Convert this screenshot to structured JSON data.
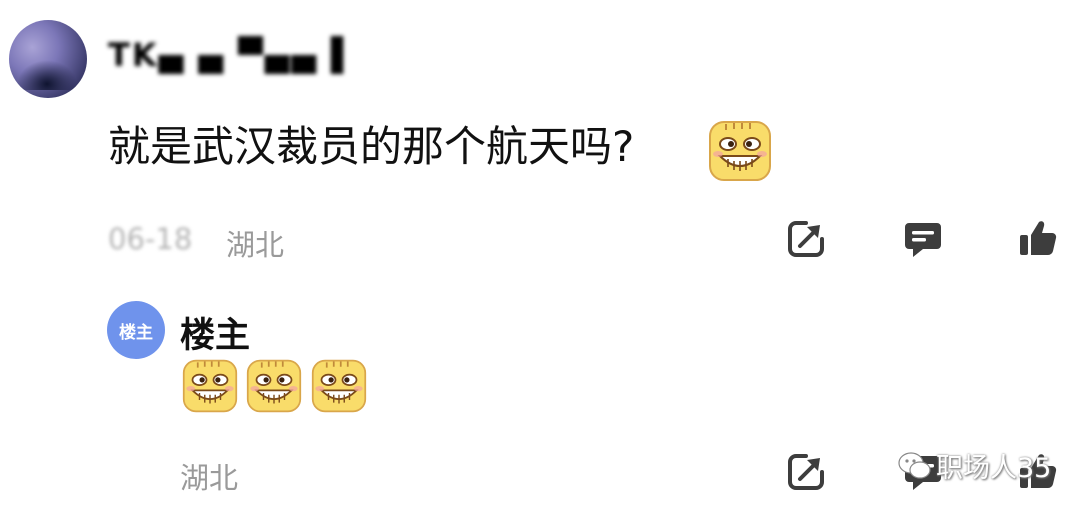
{
  "comment": {
    "username": "TK▄ ▄ ▀▄▄ ▌",
    "text": "就是武汉裁员的那个航天吗?",
    "date": "06-18",
    "location": "湖北"
  },
  "reply": {
    "avatar_label": "楼主",
    "author": "楼主",
    "emoji_count": 3,
    "location": "湖北"
  },
  "icons": {
    "share": "share-icon",
    "comment": "comment-icon",
    "like": "thumbs-up-icon",
    "emoji": "grin-emoji-icon"
  },
  "colors": {
    "text": "#111111",
    "meta": "#9a9a9a",
    "icon": "#3d3d3d",
    "author_badge": "#6f93ec",
    "emoji_fill": "#f9dc6a"
  },
  "watermark": {
    "text": "职场人35"
  }
}
